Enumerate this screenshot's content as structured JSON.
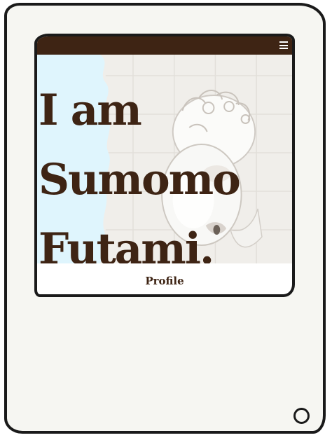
{
  "header": {
    "menu_icon": "hamburger-menu-icon"
  },
  "hero": {
    "title_line1": "I am",
    "title_line2": "Sumomo",
    "title_line3": "Futami."
  },
  "nav": {
    "profile_label": "Profile"
  },
  "device": {
    "home_icon": "circle-home-button-icon"
  },
  "colors": {
    "brand_brown": "#3e2414",
    "accent_blue": "#dff5fd",
    "screen_bg": "#ffffff",
    "device_bg": "#f6f6f2",
    "outline": "#1a1a1a"
  }
}
